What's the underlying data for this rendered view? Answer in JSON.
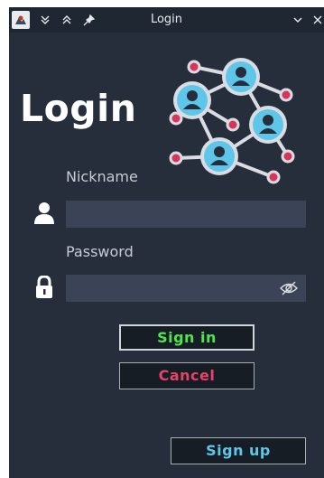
{
  "window": {
    "title": "Login"
  },
  "heading": "Login",
  "nickname": {
    "label": "Nickname",
    "value": "",
    "placeholder": ""
  },
  "password": {
    "label": "Password",
    "value": "",
    "placeholder": ""
  },
  "buttons": {
    "sign_in": "Sign in",
    "cancel": "Cancel",
    "sign_up": "Sign up"
  },
  "colors": {
    "background": "#262e3b",
    "field": "#3a4456",
    "sign_in": "#4ee44e",
    "cancel": "#e8426b",
    "sign_up": "#5ec6e8",
    "logo_node": "#5ec6e8",
    "logo_dot": "#d9345a"
  },
  "icons": {
    "titlebar": [
      "app-icon",
      "collapse-down-icon",
      "keep-above-icon",
      "pin-icon",
      "minimize-chevron-icon",
      "close-icon"
    ],
    "user_field": "user-icon",
    "password_field": "lock-icon",
    "password_toggle": "eye-slash-icon"
  }
}
